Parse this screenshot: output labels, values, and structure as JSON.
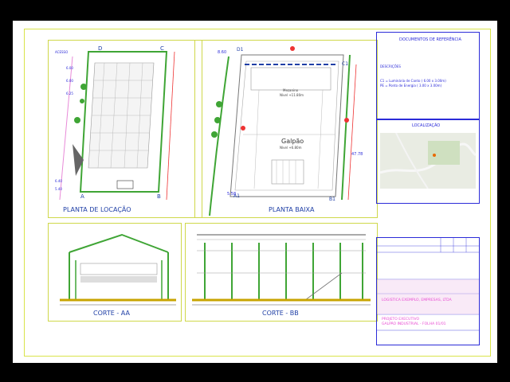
{
  "drawings": {
    "location_plan": {
      "title": "PLANTA DE LOCAÇÃO",
      "tags": [
        "ACESSO",
        "D",
        "C",
        "A",
        "B",
        "6.00",
        "6.00",
        "6.25",
        "6.40",
        "5.40"
      ]
    },
    "ground_plan": {
      "title": "PLANTA BAIXA",
      "room": "Galpão",
      "room_level": "Nível +6.80m",
      "mezz": "Mezanino",
      "mezz_level": "Nível +11.80m",
      "tags": [
        "D1",
        "C1",
        "A1",
        "B1",
        "8.60",
        "5.58",
        "47.78"
      ]
    },
    "section_aa": {
      "title": "CORTE - AA"
    },
    "section_bb": {
      "title": "CORTE - BB"
    }
  },
  "sidebar": {
    "ref_title": "DOCUMENTOS DE REFERÊNCIA",
    "ref_heading": "DESCRIÇÕES",
    "ref_lines": [
      "C1 = Luminária de Canto ( 6.00 x 3.00m)",
      "PE = Ponto de Energia ( 3.00 x 3.00m)"
    ],
    "location_title": "LOCALIZAÇÃO",
    "company": "LOGISTICA EXEMPLO, EMPRESAS, LTDA",
    "project_lines": [
      "PROJETO EXECUTIVO",
      "GALPÃO INDUSTRIAL - FOLHA 01/01"
    ]
  },
  "colors": {
    "green": "#3fa535",
    "blue": "#1f3fa6",
    "yellow": "#d9e34a",
    "magenta": "#e88ad8"
  }
}
